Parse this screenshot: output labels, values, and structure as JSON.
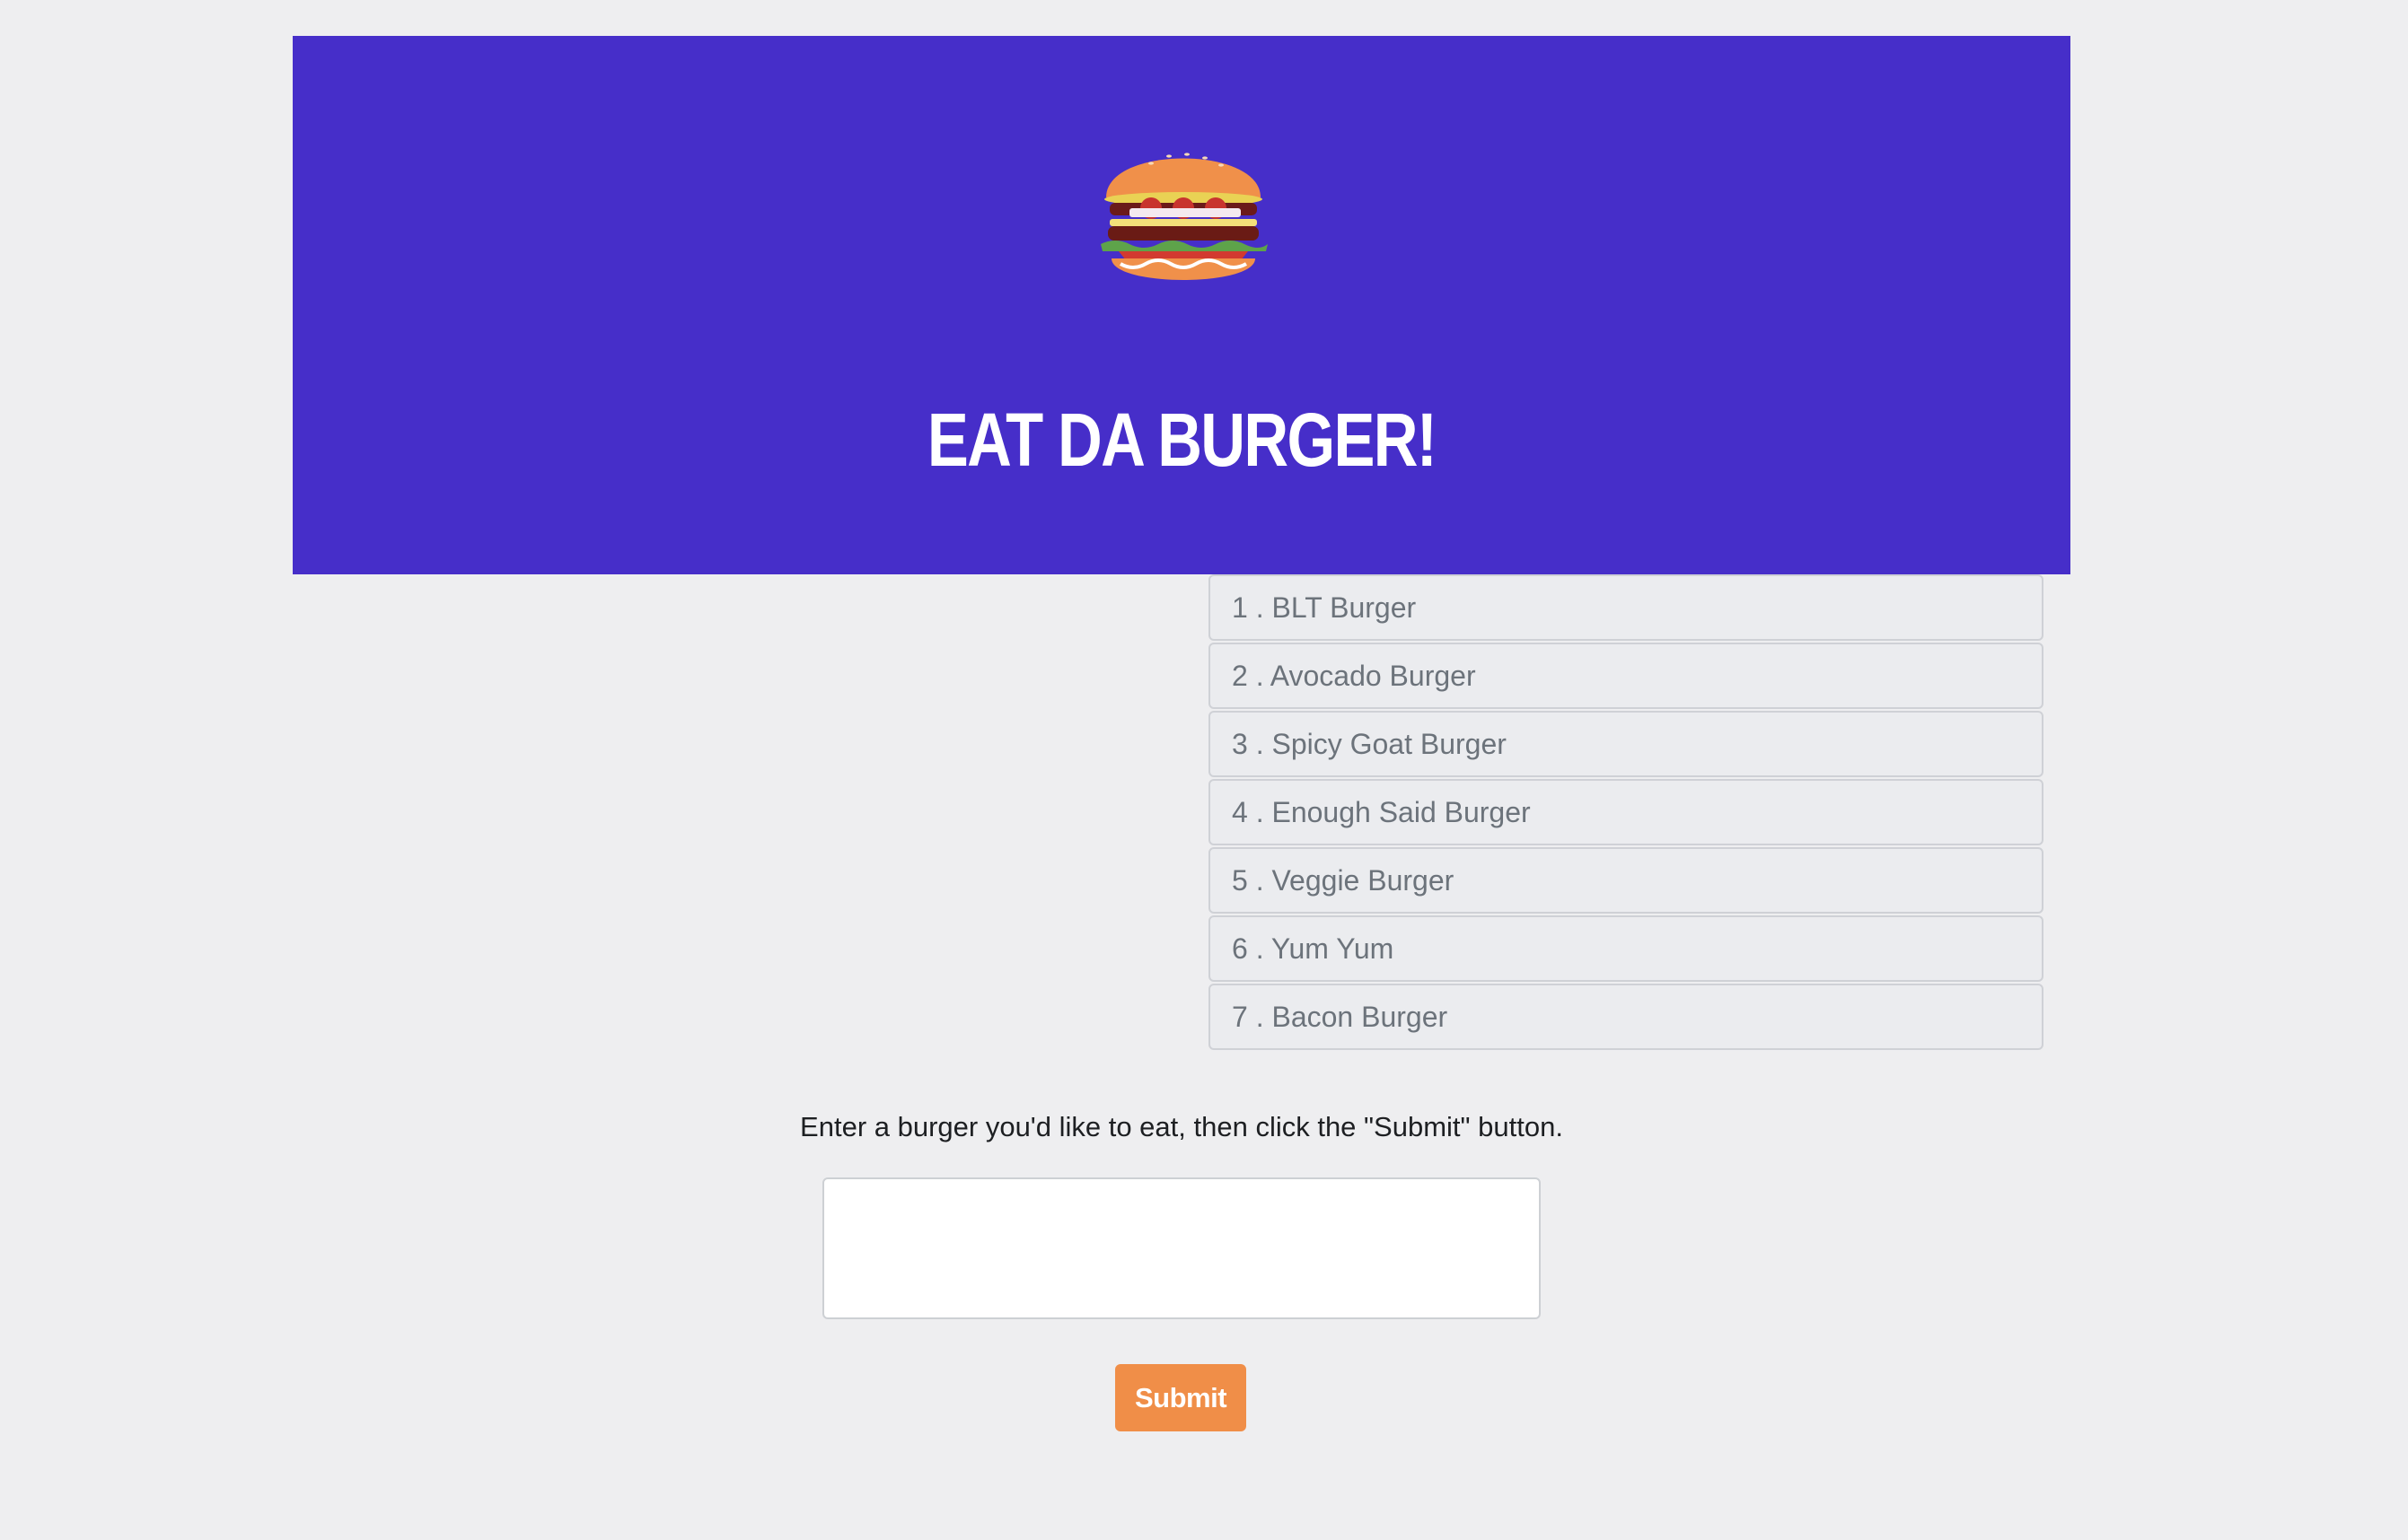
{
  "header": {
    "logo_icon": "burger-icon",
    "title": "EAT DA BURGER!",
    "background_color": "#462ec9"
  },
  "burgers": [
    {
      "label": "1 . BLT Burger"
    },
    {
      "label": "2 . Avocado Burger"
    },
    {
      "label": "3 . Spicy Goat Burger"
    },
    {
      "label": "4 . Enough Said Burger"
    },
    {
      "label": "5 . Veggie Burger"
    },
    {
      "label": "6 . Yum Yum"
    },
    {
      "label": "7 . Bacon Burger"
    }
  ],
  "form": {
    "instructions": "Enter a burger you'd like to eat, then click the \"Submit\" button.",
    "input_value": "",
    "submit_label": "Submit",
    "submit_color": "#f08e48"
  }
}
